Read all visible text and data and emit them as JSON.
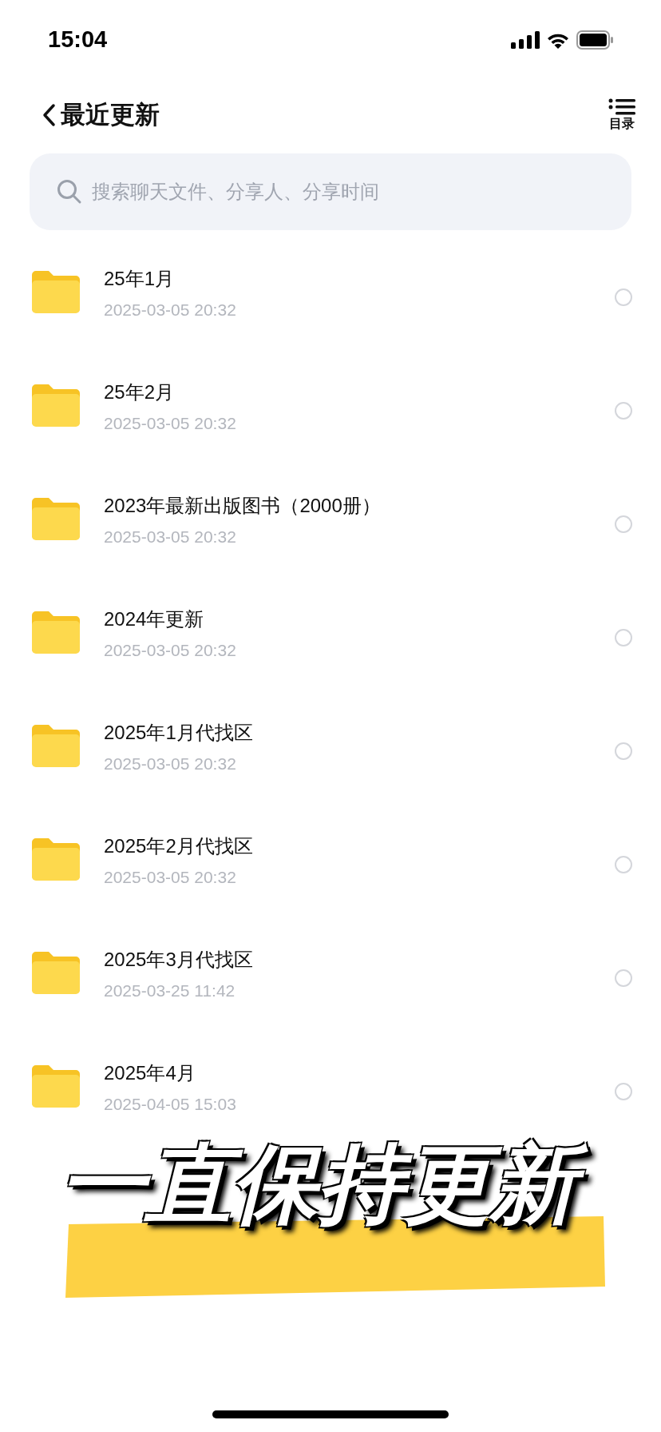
{
  "status_bar": {
    "time": "15:04"
  },
  "header": {
    "title": "最近更新",
    "menu_label": "目录"
  },
  "search": {
    "placeholder": "搜索聊天文件、分享人、分享时间"
  },
  "folders": [
    {
      "name": "25年1月",
      "date": "2025-03-05 20:32",
      "selected": false
    },
    {
      "name": "25年2月",
      "date": "2025-03-05 20:32",
      "selected": false
    },
    {
      "name": "2023年最新出版图书（2000册）",
      "date": "2025-03-05 20:32",
      "selected": false
    },
    {
      "name": "2024年更新",
      "date": "2025-03-05 20:32",
      "selected": false
    },
    {
      "name": "2025年1月代找区",
      "date": "2025-03-05 20:32",
      "selected": false
    },
    {
      "name": "2025年2月代找区",
      "date": "2025-03-05 20:32",
      "selected": false
    },
    {
      "name": "2025年3月代找区",
      "date": "2025-03-25 11:42",
      "selected": false
    },
    {
      "name": "2025年4月",
      "date": "2025-04-05 15:03",
      "selected": false
    }
  ],
  "banner": {
    "text": "一直保持更新"
  }
}
